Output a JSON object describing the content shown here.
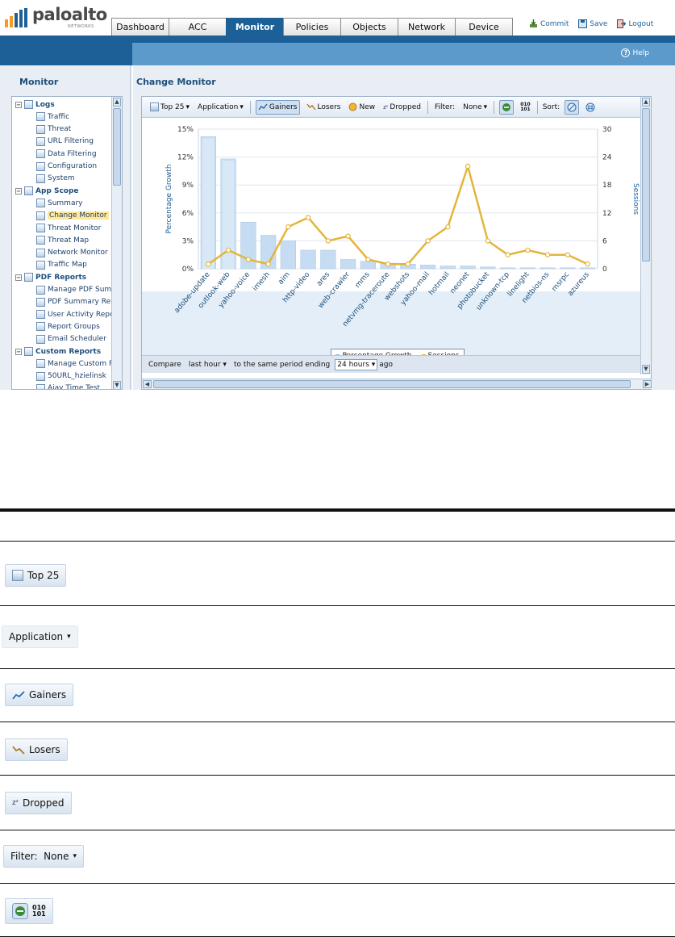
{
  "header": {
    "brand": "paloalto",
    "brand_sub": "NETWORKS",
    "tabs": [
      "Dashboard",
      "ACC",
      "Monitor",
      "Policies",
      "Objects",
      "Network",
      "Device"
    ],
    "active_tab": "Monitor",
    "actions": {
      "commit": "Commit",
      "save": "Save",
      "logout": "Logout"
    },
    "help": "Help"
  },
  "sidebar": {
    "title": "Monitor",
    "groups": [
      {
        "label": "Logs",
        "items": [
          "Traffic",
          "Threat",
          "URL Filtering",
          "Data Filtering",
          "Configuration",
          "System"
        ]
      },
      {
        "label": "App Scope",
        "items": [
          "Summary",
          "Change Monitor",
          "Threat Monitor",
          "Threat Map",
          "Network Monitor",
          "Traffic Map"
        ]
      },
      {
        "label": "PDF Reports",
        "items": [
          "Manage PDF Summ",
          "PDF Summary Rep",
          "User Activity Repo",
          "Report Groups",
          "Email Scheduler"
        ]
      },
      {
        "label": "Custom Reports",
        "items": [
          "Manage Custom R",
          "50URL_hzielinsk",
          "Ajay Time Test"
        ]
      }
    ],
    "selected": "Change Monitor"
  },
  "main": {
    "title": "Change Monitor",
    "toolbar": {
      "top": "Top 25",
      "group_by": "Application",
      "gainers": "Gainers",
      "losers": "Losers",
      "new": "New",
      "dropped": "Dropped",
      "filter_label": "Filter:",
      "filter_value": "None",
      "export_icon_text": "010\n101",
      "sort_label": "Sort:"
    },
    "compare": {
      "label": "Compare",
      "period": "last hour",
      "middle": "to the same period ending",
      "ago_value": "24 hours",
      "suffix": "ago"
    }
  },
  "chart_data": {
    "type": "bar",
    "categories": [
      "adobe-update",
      "outlook-web",
      "yahoo-voice",
      "imesh",
      "aim",
      "http-video",
      "ares",
      "web-crawler",
      "mms",
      "netvmg-traceroute",
      "webshots",
      "yahoo-mail",
      "hotmail",
      "neonet",
      "photobucket",
      "unknown-tcp",
      "linelight",
      "netbios-ns",
      "msrpc",
      "azureus"
    ],
    "series": [
      {
        "name": "Percentage Growth",
        "type": "bar",
        "axis": "left",
        "values": [
          14.2,
          11.8,
          5.0,
          3.6,
          3.0,
          2.0,
          2.0,
          1.0,
          0.8,
          0.6,
          0.5,
          0.4,
          0.3,
          0.3,
          0.2,
          0.1,
          0.1,
          0.1,
          0.1,
          0.1
        ]
      },
      {
        "name": "Sessions",
        "type": "line",
        "axis": "right",
        "values": [
          1,
          4,
          2,
          1,
          9,
          11,
          6,
          7,
          2,
          1,
          1,
          6,
          9,
          22,
          6,
          3,
          4,
          3,
          3,
          1
        ]
      }
    ],
    "ylabel": "Percentage Growth",
    "y2label": "Sessions",
    "yticks": [
      "0%",
      "3%",
      "6%",
      "9%",
      "12%",
      "15%"
    ],
    "y2ticks": [
      "0",
      "6",
      "12",
      "18",
      "24",
      "30"
    ],
    "ylim": [
      0,
      15
    ],
    "y2lim": [
      0,
      30
    ],
    "legend": [
      "Percentage Growth",
      "Sessions"
    ],
    "colors": {
      "bars": "#c6dcf2",
      "line": "#e3b53b"
    }
  },
  "reference_table": {
    "rows": [
      {
        "label": "Top 25",
        "icon": "top-25-icon"
      },
      {
        "label": "Application",
        "icon": "dropdown-arrow"
      },
      {
        "label": "Gainers",
        "icon": "gainers-icon"
      },
      {
        "label": "Losers",
        "icon": "losers-icon"
      },
      {
        "label": "Dropped",
        "icon": "dropped-icon"
      },
      {
        "label": "Filter:  None",
        "icon": "dropdown-arrow"
      },
      {
        "label": "010\n101",
        "icon": "export-icon"
      }
    ]
  }
}
